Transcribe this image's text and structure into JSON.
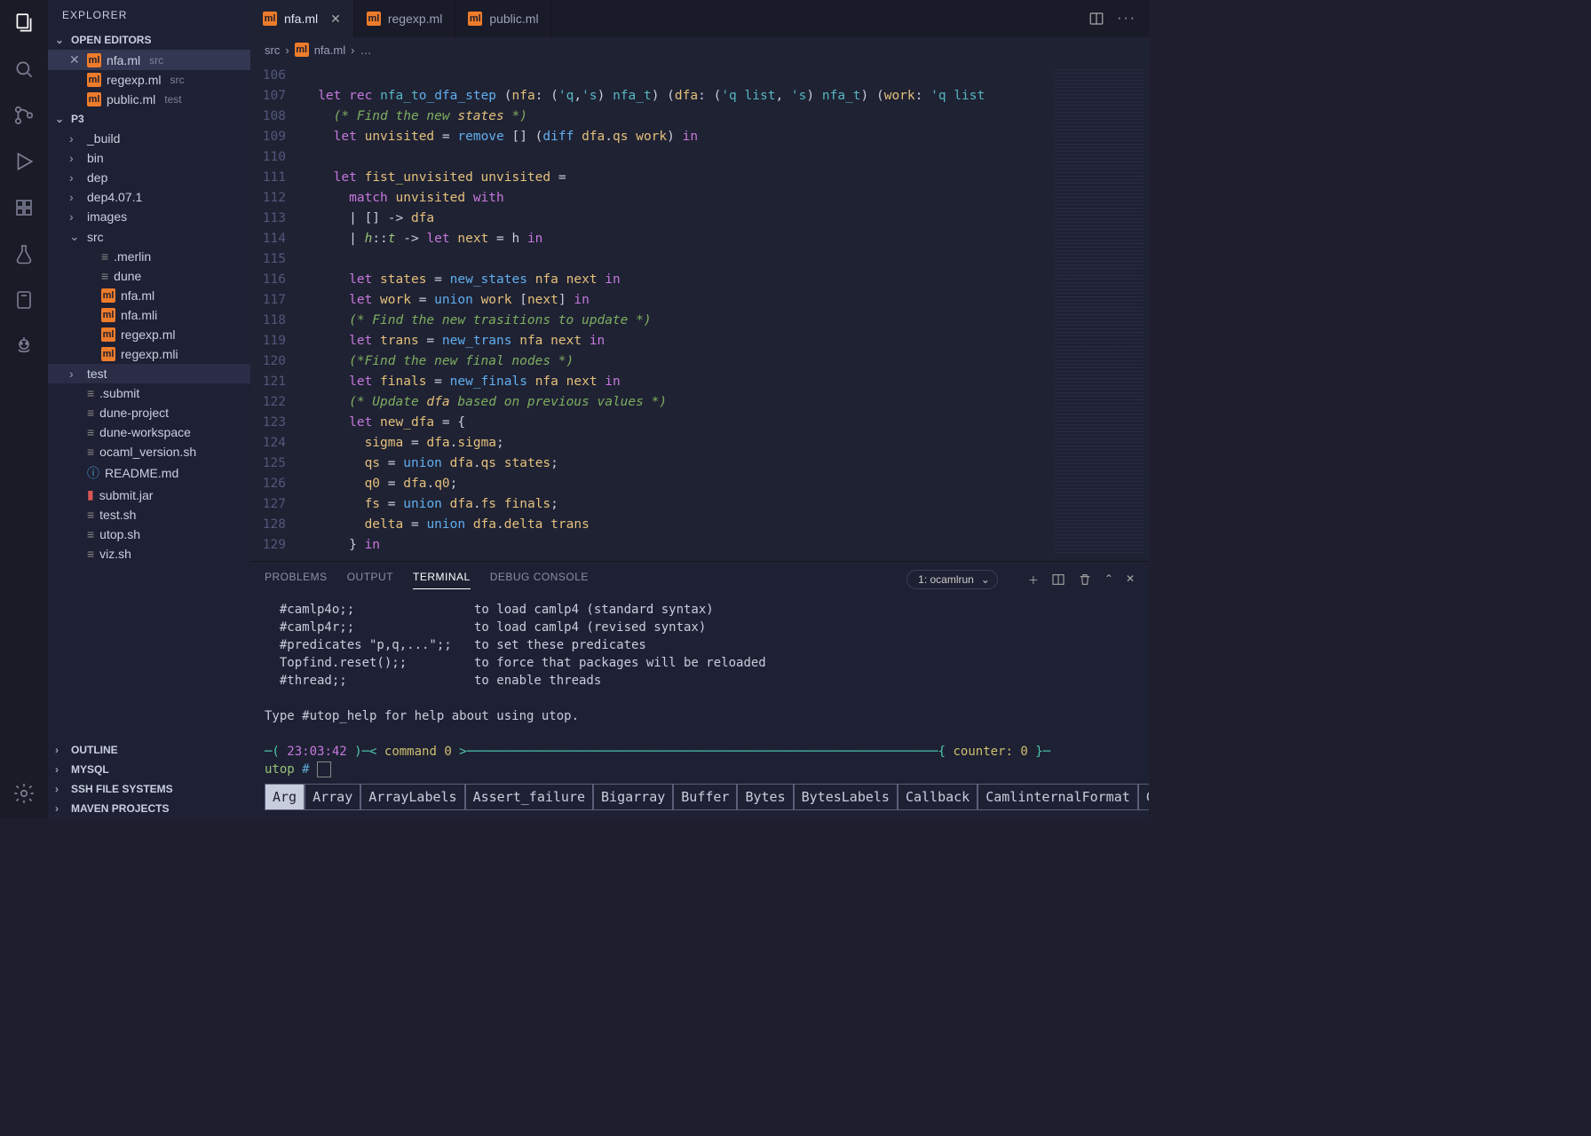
{
  "activity": {
    "items": [
      "files",
      "search",
      "git",
      "debug",
      "extensions",
      "test",
      "remote",
      "copilot"
    ],
    "settings": "settings"
  },
  "sidebar": {
    "title": "EXPLORER",
    "open_editors_label": "OPEN EDITORS",
    "open_editors": [
      {
        "name": "nfa.ml",
        "folder": "src",
        "active": true,
        "close": true
      },
      {
        "name": "regexp.ml",
        "folder": "src"
      },
      {
        "name": "public.ml",
        "folder": "test"
      }
    ],
    "project_label": "P3",
    "tree": [
      {
        "type": "folder",
        "name": "_build",
        "indent": 1
      },
      {
        "type": "folder",
        "name": "bin",
        "indent": 1
      },
      {
        "type": "folder",
        "name": "dep",
        "indent": 1
      },
      {
        "type": "folder",
        "name": "dep4.07.1",
        "indent": 1
      },
      {
        "type": "folder",
        "name": "images",
        "indent": 1
      },
      {
        "type": "folder",
        "name": "src",
        "indent": 1,
        "open": true
      },
      {
        "type": "file",
        "name": ".merlin",
        "indent": 2,
        "ico": "generic"
      },
      {
        "type": "file",
        "name": "dune",
        "indent": 2,
        "ico": "generic"
      },
      {
        "type": "file",
        "name": "nfa.ml",
        "indent": 2,
        "ico": "ml"
      },
      {
        "type": "file",
        "name": "nfa.mli",
        "indent": 2,
        "ico": "ml"
      },
      {
        "type": "file",
        "name": "regexp.ml",
        "indent": 2,
        "ico": "ml"
      },
      {
        "type": "file",
        "name": "regexp.mli",
        "indent": 2,
        "ico": "ml"
      },
      {
        "type": "folder",
        "name": "test",
        "indent": 1,
        "hover": true
      },
      {
        "type": "file",
        "name": ".submit",
        "indent": 1,
        "ico": "generic"
      },
      {
        "type": "file",
        "name": "dune-project",
        "indent": 1,
        "ico": "generic"
      },
      {
        "type": "file",
        "name": "dune-workspace",
        "indent": 1,
        "ico": "generic"
      },
      {
        "type": "file",
        "name": "ocaml_version.sh",
        "indent": 1,
        "ico": "generic"
      },
      {
        "type": "file",
        "name": "README.md",
        "indent": 1,
        "ico": "info"
      },
      {
        "type": "file",
        "name": "submit.jar",
        "indent": 1,
        "ico": "jar"
      },
      {
        "type": "file",
        "name": "test.sh",
        "indent": 1,
        "ico": "generic"
      },
      {
        "type": "file",
        "name": "utop.sh",
        "indent": 1,
        "ico": "generic"
      },
      {
        "type": "file",
        "name": "viz.sh",
        "indent": 1,
        "ico": "generic"
      }
    ],
    "bottom_sections": [
      "OUTLINE",
      "MYSQL",
      "SSH FILE SYSTEMS",
      "MAVEN PROJECTS"
    ]
  },
  "tabs": [
    {
      "name": "nfa.ml",
      "active": true,
      "close": true
    },
    {
      "name": "regexp.ml"
    },
    {
      "name": "public.ml"
    }
  ],
  "breadcrumb": {
    "parts": [
      "src",
      "nfa.ml",
      "…"
    ]
  },
  "editor": {
    "first_line": 106,
    "lines": [
      "",
      "let rec nfa_to_dfa_step (nfa: ('q,'s) nfa_t) (dfa: ('q list, 's) nfa_t) (work: 'q list",
      "  (* Find the new states *)",
      "  let unvisited = remove [] (diff dfa.qs work) in",
      "",
      "  let fist_unvisited unvisited =",
      "    match unvisited with",
      "    | [] -> dfa",
      "    | h::t -> let next = h in",
      "",
      "    let states = new_states nfa next in",
      "    let work = union work [next] in",
      "    (* Find the new trasitions to update *)",
      "    let trans = new_trans nfa next in",
      "    (*Find the new final nodes *)",
      "    let finals = new_finals nfa next in",
      "    (* Update dfa based on previous values *)",
      "    let new_dfa = {",
      "      sigma = dfa.sigma;",
      "      qs = union dfa.qs states;",
      "      q0 = dfa.q0;",
      "      fs = union dfa.fs finals;",
      "      delta = union dfa.delta trans",
      "    } in"
    ]
  },
  "panel": {
    "tabs": [
      "PROBLEMS",
      "OUTPUT",
      "TERMINAL",
      "DEBUG CONSOLE"
    ],
    "active_tab": 2,
    "select_label": "1: ocamlrun",
    "terminal_lines": [
      "  #camlp4o;;                to load camlp4 (standard syntax)",
      "  #camlp4r;;                to load camlp4 (revised syntax)",
      "  #predicates \"p,q,...\";;   to set these predicates",
      "  Topfind.reset();;         to force that packages will be reloaded",
      "  #thread;;                 to enable threads",
      "",
      "Type #utop_help for help about using utop."
    ],
    "prompt_time": "23:03:42",
    "prompt_cmd_label": "command 0",
    "counter_label": "counter: 0",
    "utop_prompt": "utop # ",
    "completions": [
      "Arg",
      "Array",
      "ArrayLabels",
      "Assert_failure",
      "Bigarray",
      "Buffer",
      "Bytes",
      "BytesLabels",
      "Callback",
      "CamlinternalFormat",
      "Caml"
    ]
  }
}
